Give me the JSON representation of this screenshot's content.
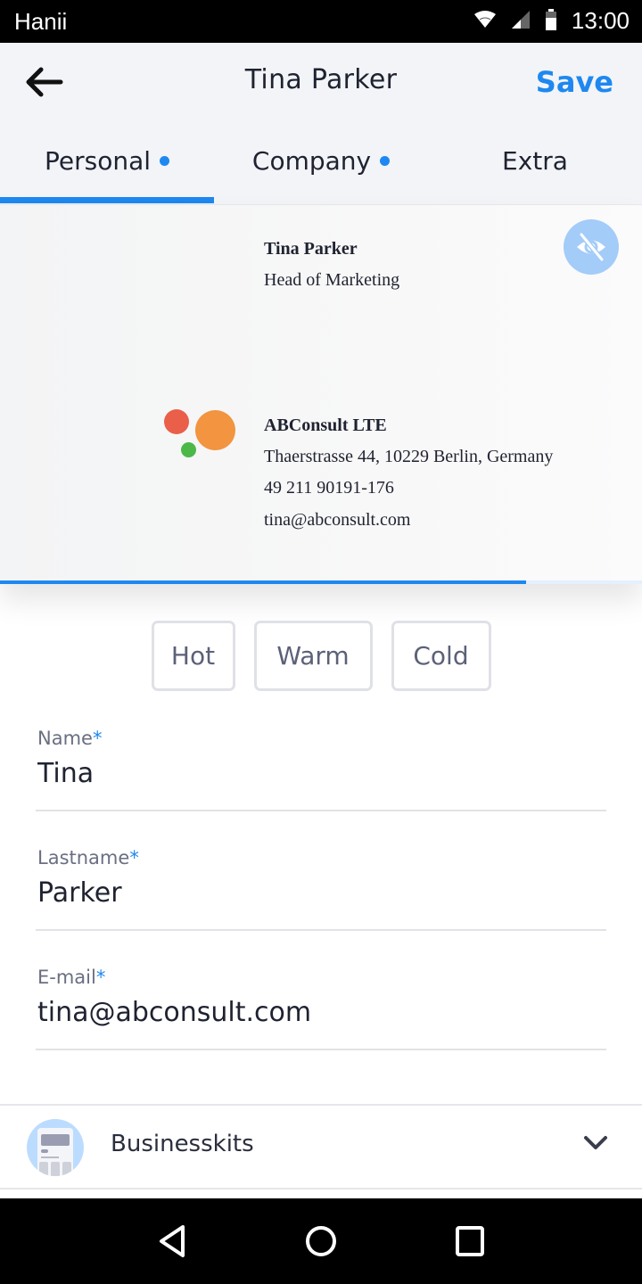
{
  "status_bar": {
    "carrier": "Hanii",
    "time": "13:00",
    "icons": [
      "wifi-icon",
      "signal-icon",
      "battery-icon"
    ]
  },
  "header": {
    "title": "Tina Parker",
    "back_icon": "arrow-left-icon",
    "save_label": "Save"
  },
  "tabs": [
    {
      "label": "Personal",
      "has_dot": true,
      "active": true
    },
    {
      "label": "Company",
      "has_dot": true,
      "active": false
    },
    {
      "label": "Extra",
      "has_dot": false,
      "active": false
    }
  ],
  "card_preview": {
    "name": "Tina Parker",
    "role": "Head of Marketing",
    "company": "ABConsult LTE",
    "address": "Thaerstrasse 44, 10229 Berlin, Germany",
    "phone": "49 211 90191-176",
    "email": "tina@abconsult.com",
    "visibility_icon": "eye-off-icon",
    "logo_colors": [
      "#e95f4a",
      "#f29440",
      "#4cb848"
    ],
    "progress_percent": 82
  },
  "temperature": {
    "options": [
      "Hot",
      "Warm",
      "Cold"
    ],
    "selected": null
  },
  "form": {
    "name": {
      "label": "Name",
      "required_mark": "*",
      "value": "Tina"
    },
    "lastname": {
      "label": "Lastname",
      "required_mark": "*",
      "value": "Parker"
    },
    "email": {
      "label": "E-mail",
      "required_mark": "*",
      "value": "tina@abconsult.com"
    }
  },
  "businesskits": {
    "label": "Businesskits",
    "icon": "businesskit-icon",
    "expand_icon": "chevron-down-icon"
  },
  "nav_bar": {
    "buttons": [
      "back-nav",
      "home-nav",
      "recents-nav"
    ]
  },
  "colors": {
    "accent": "#1e88f0",
    "header_bg": "#f2f4f8",
    "text": "#1f2230",
    "muted": "#6a6f82"
  }
}
